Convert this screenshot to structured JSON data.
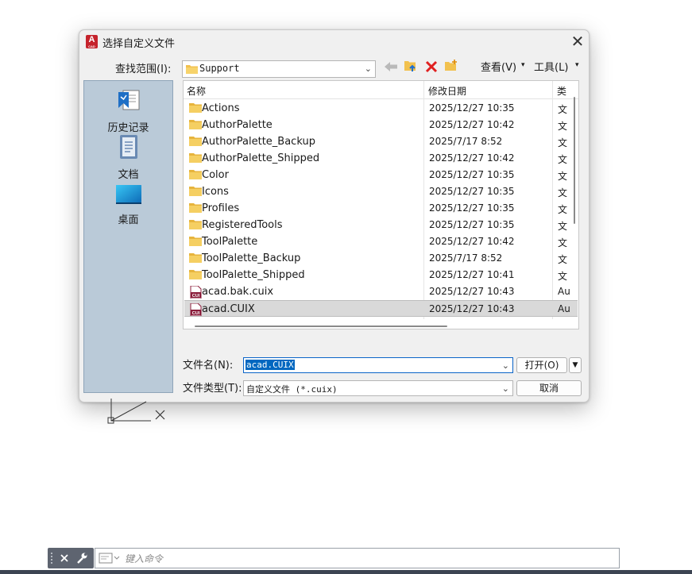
{
  "dialog": {
    "title": "选择自定义文件",
    "app_icon_text": "A",
    "app_icon_sub": "CAD",
    "close_label": "✕"
  },
  "toolbar": {
    "lookin_label": "查找范围(I):",
    "lookin_value": "Support",
    "views_label": "查看(V)",
    "tools_label": "工具(L)"
  },
  "places": [
    {
      "label": "历史记录",
      "icon": "history-icon"
    },
    {
      "label": "文档",
      "icon": "documents-icon"
    },
    {
      "label": "桌面",
      "icon": "desktop-icon"
    }
  ],
  "filelist": {
    "columns": [
      "名称",
      "修改日期",
      "类"
    ],
    "rows": [
      {
        "name": "Actions",
        "date": "2025/12/27 10:35",
        "type": "文",
        "kind": "folder"
      },
      {
        "name": "AuthorPalette",
        "date": "2025/12/27 10:42",
        "type": "文",
        "kind": "folder"
      },
      {
        "name": "AuthorPalette_Backup",
        "date": "2025/7/17 8:52",
        "type": "文",
        "kind": "folder"
      },
      {
        "name": "AuthorPalette_Shipped",
        "date": "2025/12/27 10:42",
        "type": "文",
        "kind": "folder"
      },
      {
        "name": "Color",
        "date": "2025/12/27 10:35",
        "type": "文",
        "kind": "folder"
      },
      {
        "name": "Icons",
        "date": "2025/12/27 10:35",
        "type": "文",
        "kind": "folder"
      },
      {
        "name": "Profiles",
        "date": "2025/12/27 10:35",
        "type": "文",
        "kind": "folder"
      },
      {
        "name": "RegisteredTools",
        "date": "2025/12/27 10:35",
        "type": "文",
        "kind": "folder"
      },
      {
        "name": "ToolPalette",
        "date": "2025/12/27 10:42",
        "type": "文",
        "kind": "folder"
      },
      {
        "name": "ToolPalette_Backup",
        "date": "2025/7/17 8:52",
        "type": "文",
        "kind": "folder"
      },
      {
        "name": "ToolPalette_Shipped",
        "date": "2025/12/27 10:41",
        "type": "文",
        "kind": "folder"
      },
      {
        "name": "acad.bak.cuix",
        "date": "2025/12/27 10:43",
        "type": "Au",
        "kind": "cuix"
      },
      {
        "name": "acad.CUIX",
        "date": "2025/12/27 10:43",
        "type": "Au",
        "kind": "cuix",
        "selected": true
      }
    ]
  },
  "fields": {
    "filename_label": "文件名(N):",
    "filename_value": "acad.CUIX",
    "filetype_label": "文件类型(T):",
    "filetype_value": "自定义文件 (*.cuix)",
    "open_label": "打开(O)",
    "cancel_label": "取消"
  },
  "commandline": {
    "placeholder": "键入命令"
  },
  "colors": {
    "accent": "#0067c0",
    "folder": "#f2c14e",
    "cuix": "#8b1d3b",
    "delete": "#e02020"
  }
}
